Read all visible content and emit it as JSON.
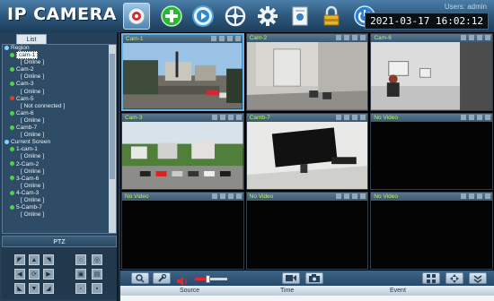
{
  "header": {
    "brand": "IP CAMERA",
    "users": "Users: admin",
    "datetime": "2021-03-17  16:02:12",
    "tools": [
      {
        "name": "camera-view",
        "icon": "webcam-icon",
        "active": true
      },
      {
        "name": "add-device",
        "icon": "plus-icon"
      },
      {
        "name": "playback",
        "icon": "play-icon"
      },
      {
        "name": "ptz-control",
        "icon": "steering-icon"
      },
      {
        "name": "settings",
        "icon": "gear-icon"
      },
      {
        "name": "device-config",
        "icon": "document-icon"
      },
      {
        "name": "lock",
        "icon": "lock-icon"
      },
      {
        "name": "power",
        "icon": "power-icon"
      }
    ]
  },
  "sidebar": {
    "tab_label": "List",
    "tree": [
      {
        "indent": 0,
        "text": "Region",
        "type": "group"
      },
      {
        "indent": 1,
        "text": "cam-1",
        "type": "cam",
        "status": "ok",
        "selected": true
      },
      {
        "indent": 3,
        "text": "[   Online   ]",
        "type": "status"
      },
      {
        "indent": 1,
        "text": "Cam-2",
        "type": "cam",
        "status": "ok"
      },
      {
        "indent": 3,
        "text": "[   Online   ]",
        "type": "status"
      },
      {
        "indent": 1,
        "text": "Cam-3",
        "type": "cam",
        "status": "ok"
      },
      {
        "indent": 3,
        "text": "[   Online   ]",
        "type": "status"
      },
      {
        "indent": 1,
        "text": "Cam-5",
        "type": "cam",
        "status": "err"
      },
      {
        "indent": 3,
        "text": "[   Not connected   ]",
        "type": "status"
      },
      {
        "indent": 1,
        "text": "Cam-6",
        "type": "cam",
        "status": "ok"
      },
      {
        "indent": 3,
        "text": "[   Online   ]",
        "type": "status"
      },
      {
        "indent": 1,
        "text": "Camb-7",
        "type": "cam",
        "status": "ok"
      },
      {
        "indent": 3,
        "text": "[   Online   ]",
        "type": "status"
      },
      {
        "indent": 0,
        "text": "Current Screen",
        "type": "group"
      },
      {
        "indent": 1,
        "text": "1-cam-1",
        "type": "cam",
        "status": "ok"
      },
      {
        "indent": 3,
        "text": "[   Online   ]",
        "type": "status"
      },
      {
        "indent": 1,
        "text": "2-Cam-2",
        "type": "cam",
        "status": "ok"
      },
      {
        "indent": 3,
        "text": "[   Online   ]",
        "type": "status"
      },
      {
        "indent": 1,
        "text": "3-Cam-6",
        "type": "cam",
        "status": "ok"
      },
      {
        "indent": 3,
        "text": "[   Online   ]",
        "type": "status"
      },
      {
        "indent": 1,
        "text": "4-Cam-3",
        "type": "cam",
        "status": "ok"
      },
      {
        "indent": 3,
        "text": "[   Online   ]",
        "type": "status"
      },
      {
        "indent": 1,
        "text": "5-Camb-7",
        "type": "cam",
        "status": "ok"
      },
      {
        "indent": 3,
        "text": "[   Online   ]",
        "type": "status"
      }
    ],
    "ptz_title": "PTZ"
  },
  "grid": {
    "cells": [
      {
        "title": "Cam-1",
        "scene": "construction",
        "focus": true
      },
      {
        "title": "Cam-2",
        "scene": "office-room"
      },
      {
        "title": "Cam-6",
        "scene": "office-desk"
      },
      {
        "title": "Cam-3",
        "scene": "parking"
      },
      {
        "title": "Camb-7",
        "scene": "monitor-desk"
      },
      {
        "title": "No Video",
        "scene": "none"
      },
      {
        "title": "No Video",
        "scene": "none"
      },
      {
        "title": "No Video",
        "scene": "none"
      },
      {
        "title": "No Video",
        "scene": "none"
      }
    ]
  },
  "events": {
    "columns": [
      "Source",
      "Time",
      "Event"
    ]
  },
  "colors": {
    "accent": "#5db6ee",
    "cam_title": "#b6f25a",
    "online": "#4fd14a",
    "error": "#e23b2a"
  }
}
